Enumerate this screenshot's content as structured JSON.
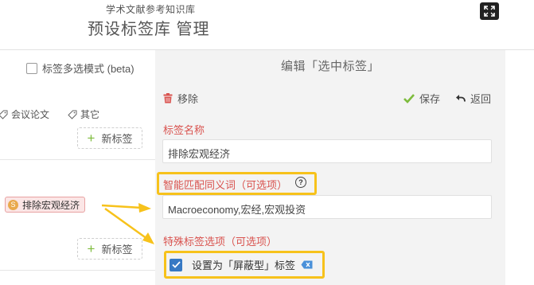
{
  "header": {
    "subtitle": "学术文献参考知识库",
    "title": "预设标签库 管理"
  },
  "left_panel": {
    "multi_select_label": "标签多选模式 (beta)",
    "tag_row": [
      "会议论文",
      "其它"
    ],
    "new_tag_label": "新标签",
    "selected_tag": {
      "label": "排除宏观经济",
      "icon_letter": "S"
    }
  },
  "editor": {
    "title": "编辑「选中标签」",
    "remove_label": "移除",
    "save_label": "保存",
    "back_label": "返回",
    "name_section_label": "标签名称",
    "name_value": "排除宏观经济",
    "synonyms_section_label": "智能匹配同义词（可选项）",
    "synonyms_value": "Macroeconomy,宏经,宏观投资",
    "special_section_label": "特殊标签选项（可选项）",
    "special_option_label": "设置为「屏蔽型」标签",
    "special_option_checked": true
  },
  "colors": {
    "accent_red": "#d9534f",
    "highlight": "#f7c21b",
    "check_blue": "#3779c4",
    "save_green": "#7dbb3c"
  }
}
